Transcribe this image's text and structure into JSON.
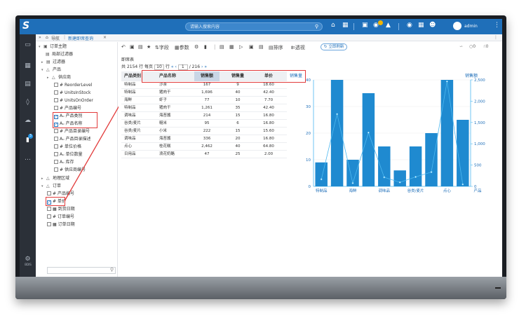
{
  "app": {
    "search_placeholder": "请输入搜索内容",
    "username": "admin"
  },
  "rail": {
    "badge": "3",
    "bottom_label": "BDIS"
  },
  "tabs": {
    "home": "导航",
    "active": "新建即席查询",
    "close": "×"
  },
  "tree": {
    "root": "订单主题",
    "items": [
      "局部过滤器",
      "过滤器",
      "产品",
      "供应商",
      "ReorderLevel",
      "UnitsInStock",
      "UnitsOnOrder",
      "产品编号",
      "产品类别",
      "产品名称",
      "产品目录编号",
      "产品目录描述",
      "单位价格",
      "单位数量",
      "库存",
      "供应商编号",
      "地理区域",
      "订单",
      "产品编号",
      "单价",
      "到货日期",
      "订单编号",
      "订单日期"
    ]
  },
  "toolbar": {
    "items": [
      "字段",
      "参数",
      "排序",
      "透视"
    ],
    "refresh": "立即刷新",
    "right": [
      "0",
      "0"
    ]
  },
  "report": {
    "title": "即席表",
    "pager": {
      "total_prefix": "共",
      "total": "2154",
      "rows_label": "行 每页",
      "per_page": "10",
      "per_page_suffix": "行",
      "current_page": "1",
      "pages": "/ 216"
    },
    "columns": [
      "产品类别",
      "产品名称",
      "销售额",
      "销售量",
      "单价"
    ],
    "rows": [
      [
        "特制品",
        "沙茶",
        "167",
        "9",
        "18.60"
      ],
      [
        "特制品",
        "猪肉干",
        "1,696",
        "40",
        "42.40"
      ],
      [
        "海鲜",
        "虾子",
        "77",
        "10",
        "7.70"
      ],
      [
        "特制品",
        "猪肉干",
        "1,261",
        "35",
        "42.40"
      ],
      [
        "调味品",
        "海苔酱",
        "214",
        "15",
        "16.80"
      ],
      [
        "谷类/麦片",
        "糙米",
        "95",
        "6",
        "16.80"
      ],
      [
        "谷类/麦片",
        "小米",
        "222",
        "15",
        "15.60"
      ],
      [
        "调味品",
        "海苔酱",
        "336",
        "20",
        "16.80"
      ],
      [
        "点心",
        "桂花糕",
        "2,462",
        "40",
        "64.80"
      ],
      [
        "日用品",
        "浪花奶酪",
        "47",
        "25",
        "2.00"
      ]
    ]
  },
  "chart_data": {
    "type": "bar",
    "ylabel_left": "销售量",
    "ylabel_right": "销售额",
    "categories": [
      "特制品",
      "特制品",
      "海鲜",
      "特制品",
      "调味品",
      "谷类/麦片",
      "谷类/麦片",
      "调味品",
      "点心",
      "日用品"
    ],
    "x_tick_labels": [
      "特制品",
      "海鲜",
      "调味品",
      "谷类/麦片",
      "点心",
      "产品"
    ],
    "series": [
      {
        "name": "销售量",
        "axis": "left",
        "kind": "bar",
        "values": [
          9,
          40,
          10,
          35,
          15,
          6,
          15,
          20,
          40,
          25
        ]
      },
      {
        "name": "销售额",
        "axis": "right",
        "kind": "line",
        "values": [
          167,
          1696,
          77,
          1261,
          214,
          95,
          222,
          336,
          2462,
          47
        ]
      }
    ],
    "ylim_left": [
      0,
      40
    ],
    "yticks_left": [
      0,
      10,
      20,
      30,
      40
    ],
    "ylim_right": [
      0,
      2500
    ],
    "yticks_right": [
      "0",
      "500",
      "1,000",
      "1,500",
      "2,000",
      "2,500"
    ],
    "colors": {
      "bar": "#1f8ad0",
      "line": "#4db8f0"
    },
    "grid": true
  }
}
